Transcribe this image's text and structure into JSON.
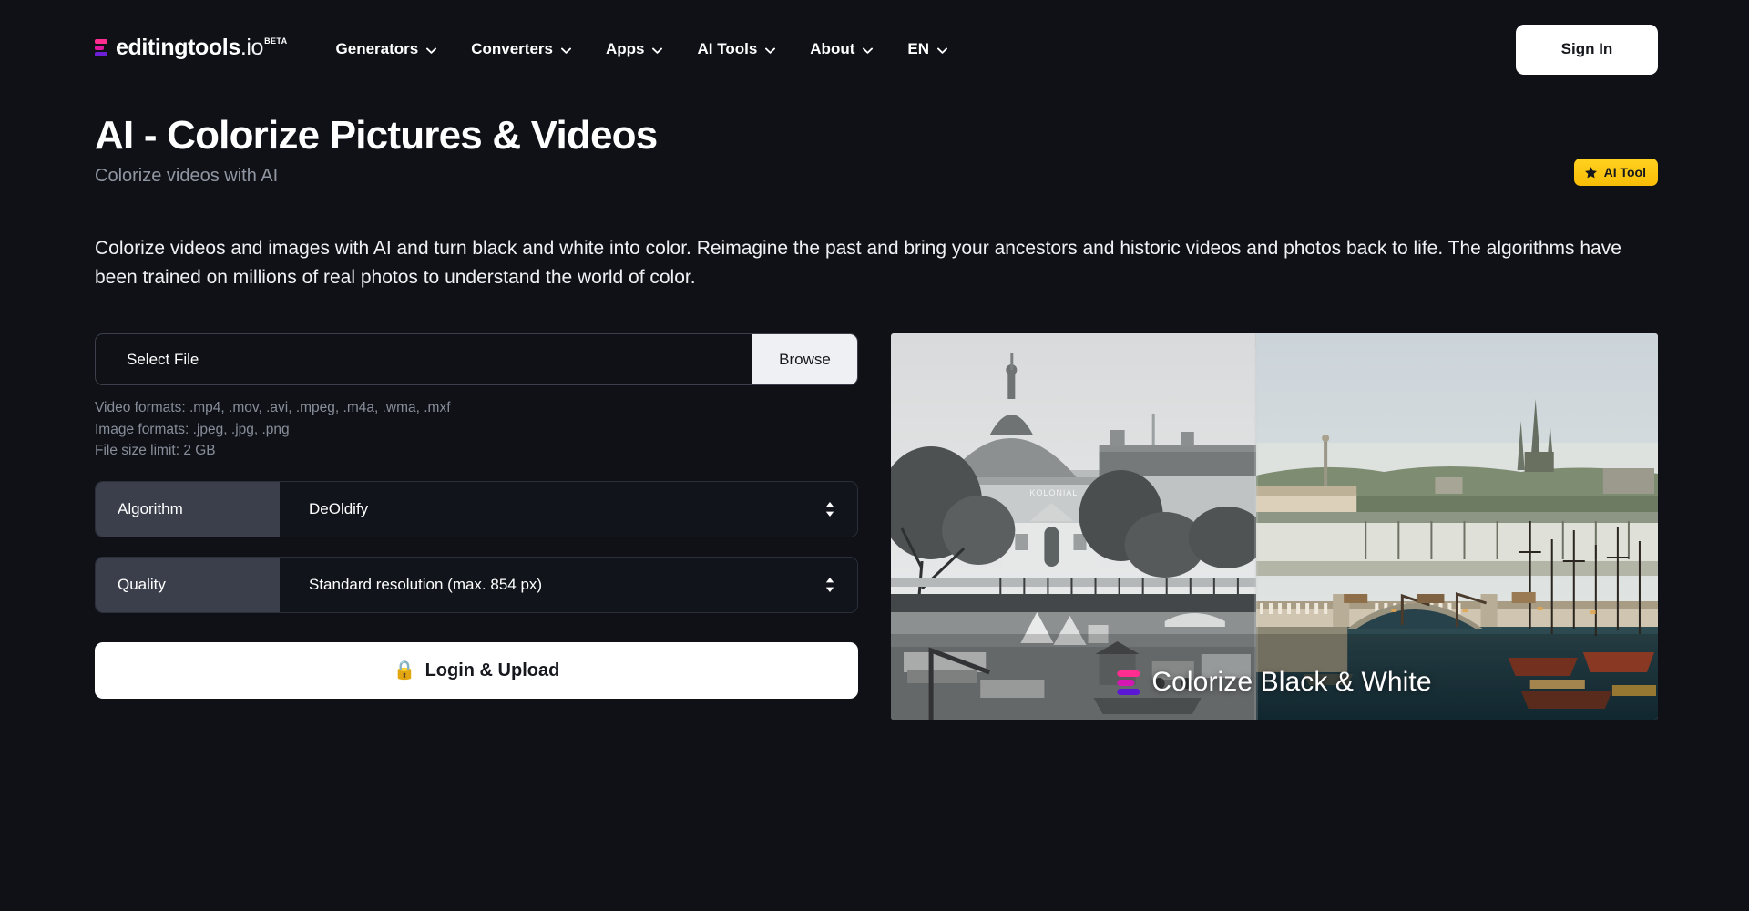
{
  "brand": {
    "name_bold": "editingtools",
    "name_light": ".io",
    "superscript": "BETA",
    "logo_icon": "stacked-bars-logo"
  },
  "nav": {
    "items": [
      {
        "label": "Generators",
        "icon": "chevron-down-icon"
      },
      {
        "label": "Converters",
        "icon": "chevron-down-icon"
      },
      {
        "label": "Apps",
        "icon": "chevron-down-icon"
      },
      {
        "label": "AI Tools",
        "icon": "chevron-down-icon"
      },
      {
        "label": "About",
        "icon": "chevron-down-icon"
      },
      {
        "label": "EN",
        "icon": "chevron-down-icon"
      }
    ],
    "sign_in": "Sign In"
  },
  "hero": {
    "title": "AI - Colorize Pictures & Videos",
    "subtitle": "Colorize videos with AI",
    "badge": {
      "label": "AI Tool",
      "icon": "star-icon",
      "color": "#ffd21f"
    },
    "description": "Colorize videos and images with AI and turn black and white into color. Reimagine the past and bring your ancestors and historic videos and photos back to life. The algorithms have been trained on millions of real photos to understand the world of color."
  },
  "uploader": {
    "file_label": "Select File",
    "browse_label": "Browse",
    "notes": [
      "Video formats: .mp4, .mov, .avi, .mpeg, .m4a, .wma, .mxf",
      "Image formats: .jpeg, .jpg, .png",
      "File size limit: 2 GB"
    ],
    "fields": [
      {
        "label": "Algorithm",
        "value": "DeOldify",
        "icon": "select-arrows-icon"
      },
      {
        "label": "Quality",
        "value": "Standard resolution (max. 854 px)",
        "icon": "select-arrows-icon"
      }
    ],
    "submit": {
      "label": "Login & Upload",
      "icon": "lock-icon",
      "glyph": "🔒"
    }
  },
  "preview": {
    "caption": "Colorize Black & White",
    "logo_icon": "stacked-bars-logo",
    "alt": "Historic cityscape photograph, left half black and white, right half colorized"
  },
  "colors": {
    "background": "#0f1117",
    "accent_pink": "#ff2d8f",
    "accent_purple": "#5c17d6",
    "badge_yellow": "#ffd21f",
    "surface": "#3a3f4b"
  }
}
